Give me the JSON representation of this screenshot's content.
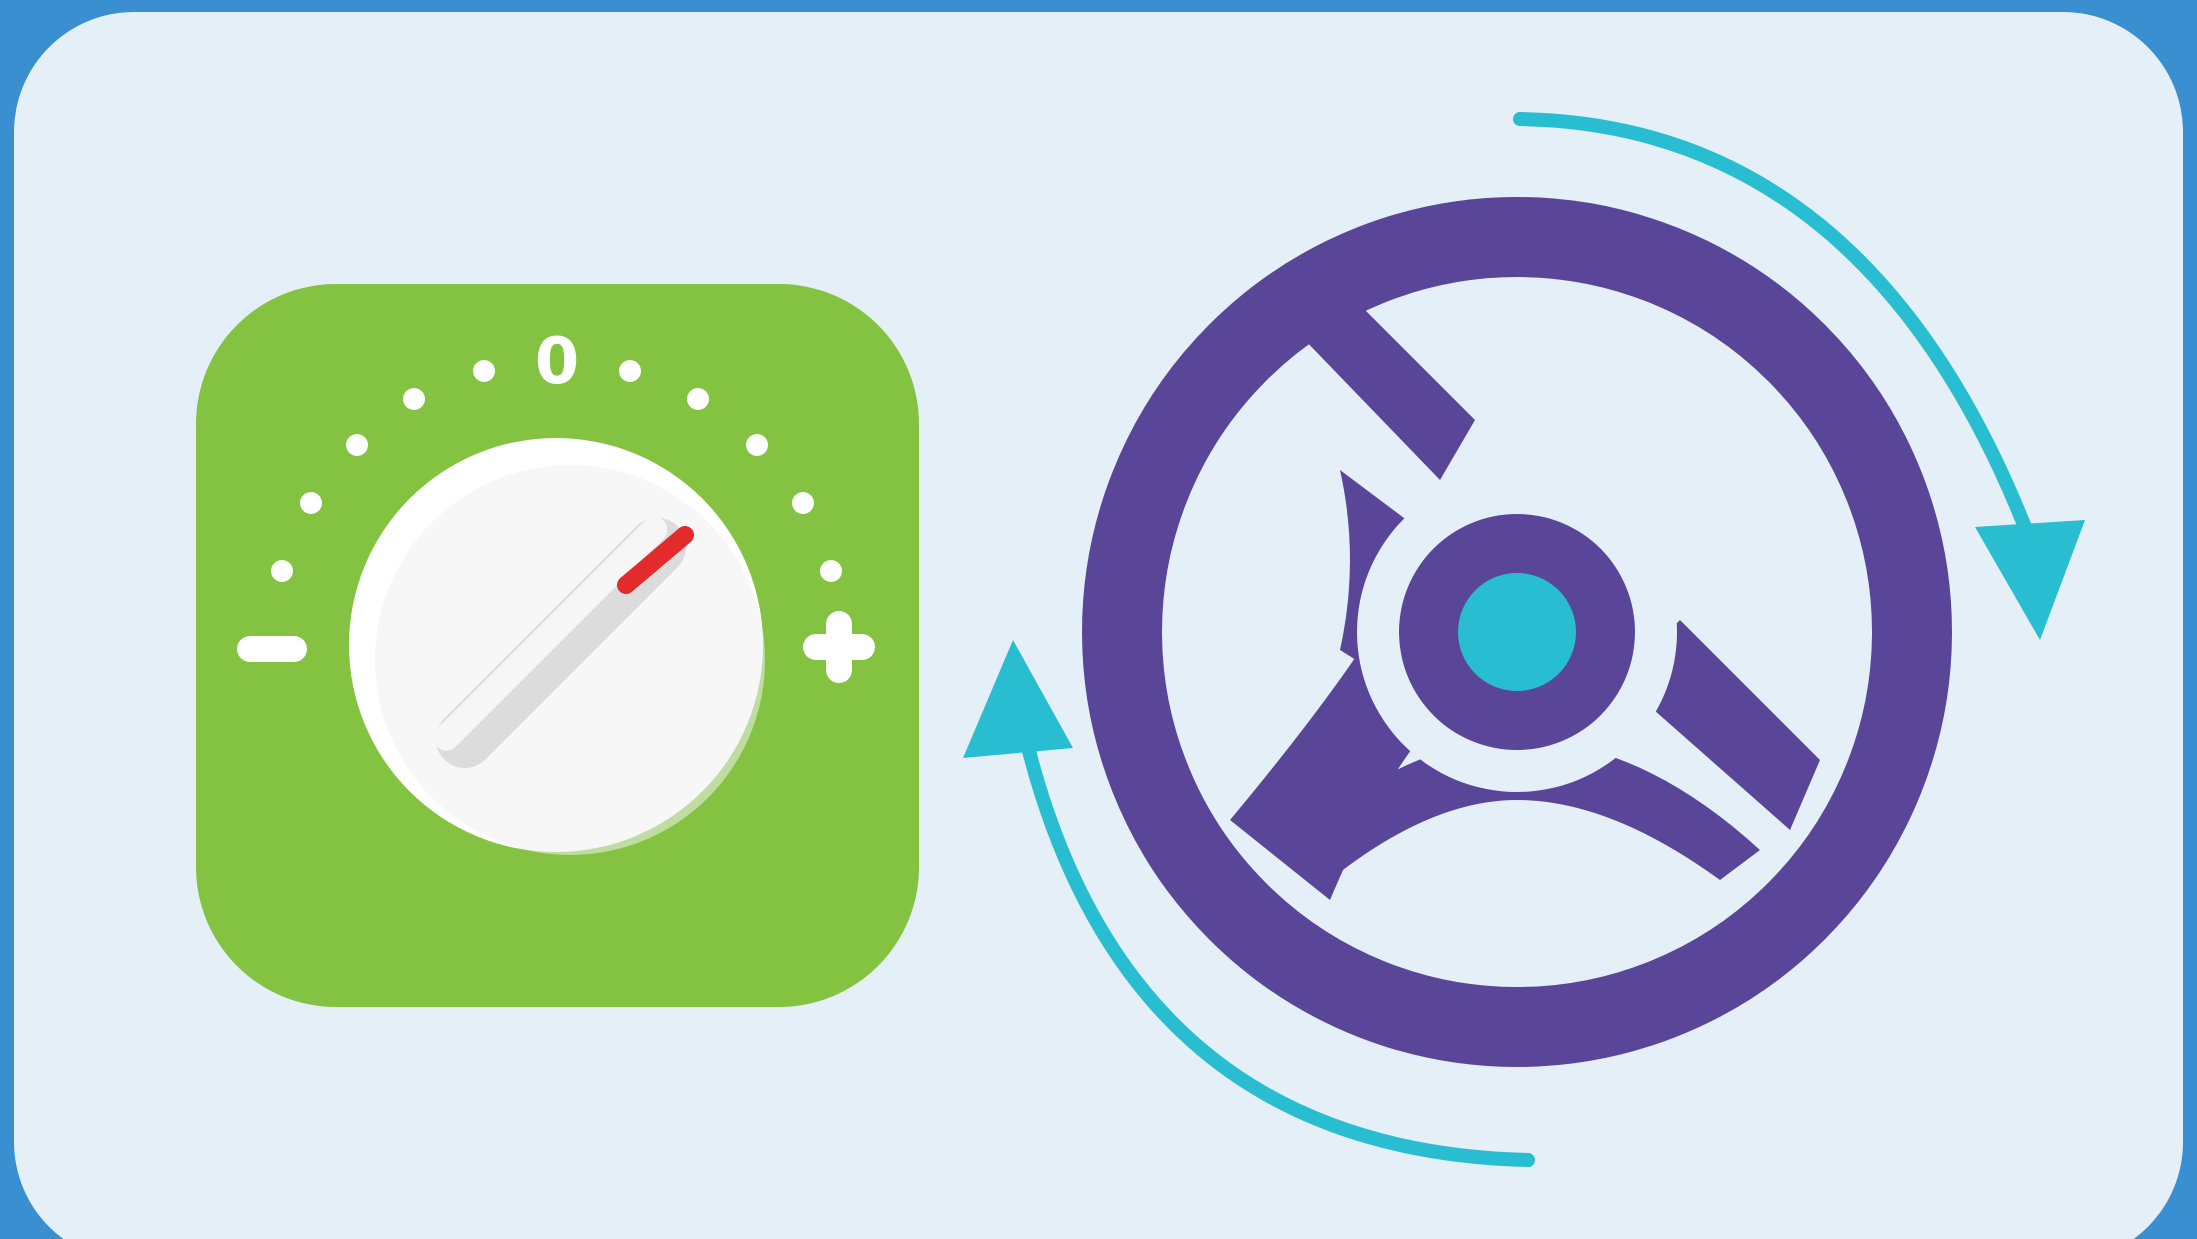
{
  "colors": {
    "frame_border": "#3a8fd0",
    "panel_background": "#e4eff7",
    "knob_tile": "#83c341",
    "knob_body": "#ffffff",
    "knob_indicator": "#e32b2b",
    "steering_wheel": "#5a4699",
    "wheel_hub_center": "#28bdd0",
    "rotation_arrows": "#28bdd0"
  },
  "knob_panel": {
    "minus_symbol": "−",
    "zero_label": "0",
    "plus_symbol": "+"
  },
  "icons": {
    "knob": "control-knob-icon",
    "wheel": "steering-wheel-icon",
    "arrow_clockwise": "rotate-clockwise-arrow-icon",
    "arrow_counterclockwise": "rotate-counterclockwise-arrow-icon"
  }
}
